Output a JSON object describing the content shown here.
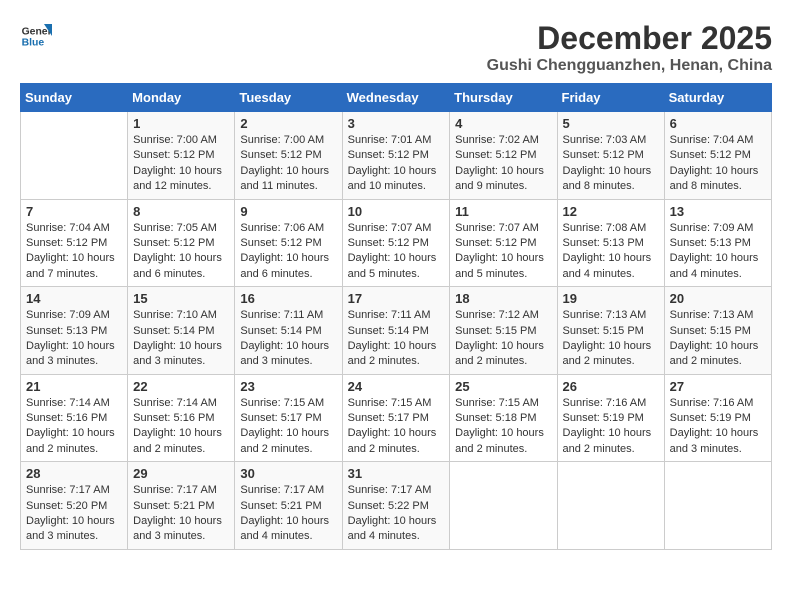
{
  "logo": {
    "line1": "General",
    "line2": "Blue"
  },
  "title": "December 2025",
  "location": "Gushi Chengguanzhen, Henan, China",
  "weekdays": [
    "Sunday",
    "Monday",
    "Tuesday",
    "Wednesday",
    "Thursday",
    "Friday",
    "Saturday"
  ],
  "weeks": [
    [
      {
        "day": "",
        "info": ""
      },
      {
        "day": "1",
        "info": "Sunrise: 7:00 AM\nSunset: 5:12 PM\nDaylight: 10 hours\nand 12 minutes."
      },
      {
        "day": "2",
        "info": "Sunrise: 7:00 AM\nSunset: 5:12 PM\nDaylight: 10 hours\nand 11 minutes."
      },
      {
        "day": "3",
        "info": "Sunrise: 7:01 AM\nSunset: 5:12 PM\nDaylight: 10 hours\nand 10 minutes."
      },
      {
        "day": "4",
        "info": "Sunrise: 7:02 AM\nSunset: 5:12 PM\nDaylight: 10 hours\nand 9 minutes."
      },
      {
        "day": "5",
        "info": "Sunrise: 7:03 AM\nSunset: 5:12 PM\nDaylight: 10 hours\nand 8 minutes."
      },
      {
        "day": "6",
        "info": "Sunrise: 7:04 AM\nSunset: 5:12 PM\nDaylight: 10 hours\nand 8 minutes."
      }
    ],
    [
      {
        "day": "7",
        "info": "Sunrise: 7:04 AM\nSunset: 5:12 PM\nDaylight: 10 hours\nand 7 minutes."
      },
      {
        "day": "8",
        "info": "Sunrise: 7:05 AM\nSunset: 5:12 PM\nDaylight: 10 hours\nand 6 minutes."
      },
      {
        "day": "9",
        "info": "Sunrise: 7:06 AM\nSunset: 5:12 PM\nDaylight: 10 hours\nand 6 minutes."
      },
      {
        "day": "10",
        "info": "Sunrise: 7:07 AM\nSunset: 5:12 PM\nDaylight: 10 hours\nand 5 minutes."
      },
      {
        "day": "11",
        "info": "Sunrise: 7:07 AM\nSunset: 5:12 PM\nDaylight: 10 hours\nand 5 minutes."
      },
      {
        "day": "12",
        "info": "Sunrise: 7:08 AM\nSunset: 5:13 PM\nDaylight: 10 hours\nand 4 minutes."
      },
      {
        "day": "13",
        "info": "Sunrise: 7:09 AM\nSunset: 5:13 PM\nDaylight: 10 hours\nand 4 minutes."
      }
    ],
    [
      {
        "day": "14",
        "info": "Sunrise: 7:09 AM\nSunset: 5:13 PM\nDaylight: 10 hours\nand 3 minutes."
      },
      {
        "day": "15",
        "info": "Sunrise: 7:10 AM\nSunset: 5:14 PM\nDaylight: 10 hours\nand 3 minutes."
      },
      {
        "day": "16",
        "info": "Sunrise: 7:11 AM\nSunset: 5:14 PM\nDaylight: 10 hours\nand 3 minutes."
      },
      {
        "day": "17",
        "info": "Sunrise: 7:11 AM\nSunset: 5:14 PM\nDaylight: 10 hours\nand 2 minutes."
      },
      {
        "day": "18",
        "info": "Sunrise: 7:12 AM\nSunset: 5:15 PM\nDaylight: 10 hours\nand 2 minutes."
      },
      {
        "day": "19",
        "info": "Sunrise: 7:13 AM\nSunset: 5:15 PM\nDaylight: 10 hours\nand 2 minutes."
      },
      {
        "day": "20",
        "info": "Sunrise: 7:13 AM\nSunset: 5:15 PM\nDaylight: 10 hours\nand 2 minutes."
      }
    ],
    [
      {
        "day": "21",
        "info": "Sunrise: 7:14 AM\nSunset: 5:16 PM\nDaylight: 10 hours\nand 2 minutes."
      },
      {
        "day": "22",
        "info": "Sunrise: 7:14 AM\nSunset: 5:16 PM\nDaylight: 10 hours\nand 2 minutes."
      },
      {
        "day": "23",
        "info": "Sunrise: 7:15 AM\nSunset: 5:17 PM\nDaylight: 10 hours\nand 2 minutes."
      },
      {
        "day": "24",
        "info": "Sunrise: 7:15 AM\nSunset: 5:17 PM\nDaylight: 10 hours\nand 2 minutes."
      },
      {
        "day": "25",
        "info": "Sunrise: 7:15 AM\nSunset: 5:18 PM\nDaylight: 10 hours\nand 2 minutes."
      },
      {
        "day": "26",
        "info": "Sunrise: 7:16 AM\nSunset: 5:19 PM\nDaylight: 10 hours\nand 2 minutes."
      },
      {
        "day": "27",
        "info": "Sunrise: 7:16 AM\nSunset: 5:19 PM\nDaylight: 10 hours\nand 3 minutes."
      }
    ],
    [
      {
        "day": "28",
        "info": "Sunrise: 7:17 AM\nSunset: 5:20 PM\nDaylight: 10 hours\nand 3 minutes."
      },
      {
        "day": "29",
        "info": "Sunrise: 7:17 AM\nSunset: 5:21 PM\nDaylight: 10 hours\nand 3 minutes."
      },
      {
        "day": "30",
        "info": "Sunrise: 7:17 AM\nSunset: 5:21 PM\nDaylight: 10 hours\nand 4 minutes."
      },
      {
        "day": "31",
        "info": "Sunrise: 7:17 AM\nSunset: 5:22 PM\nDaylight: 10 hours\nand 4 minutes."
      },
      {
        "day": "",
        "info": ""
      },
      {
        "day": "",
        "info": ""
      },
      {
        "day": "",
        "info": ""
      }
    ]
  ]
}
